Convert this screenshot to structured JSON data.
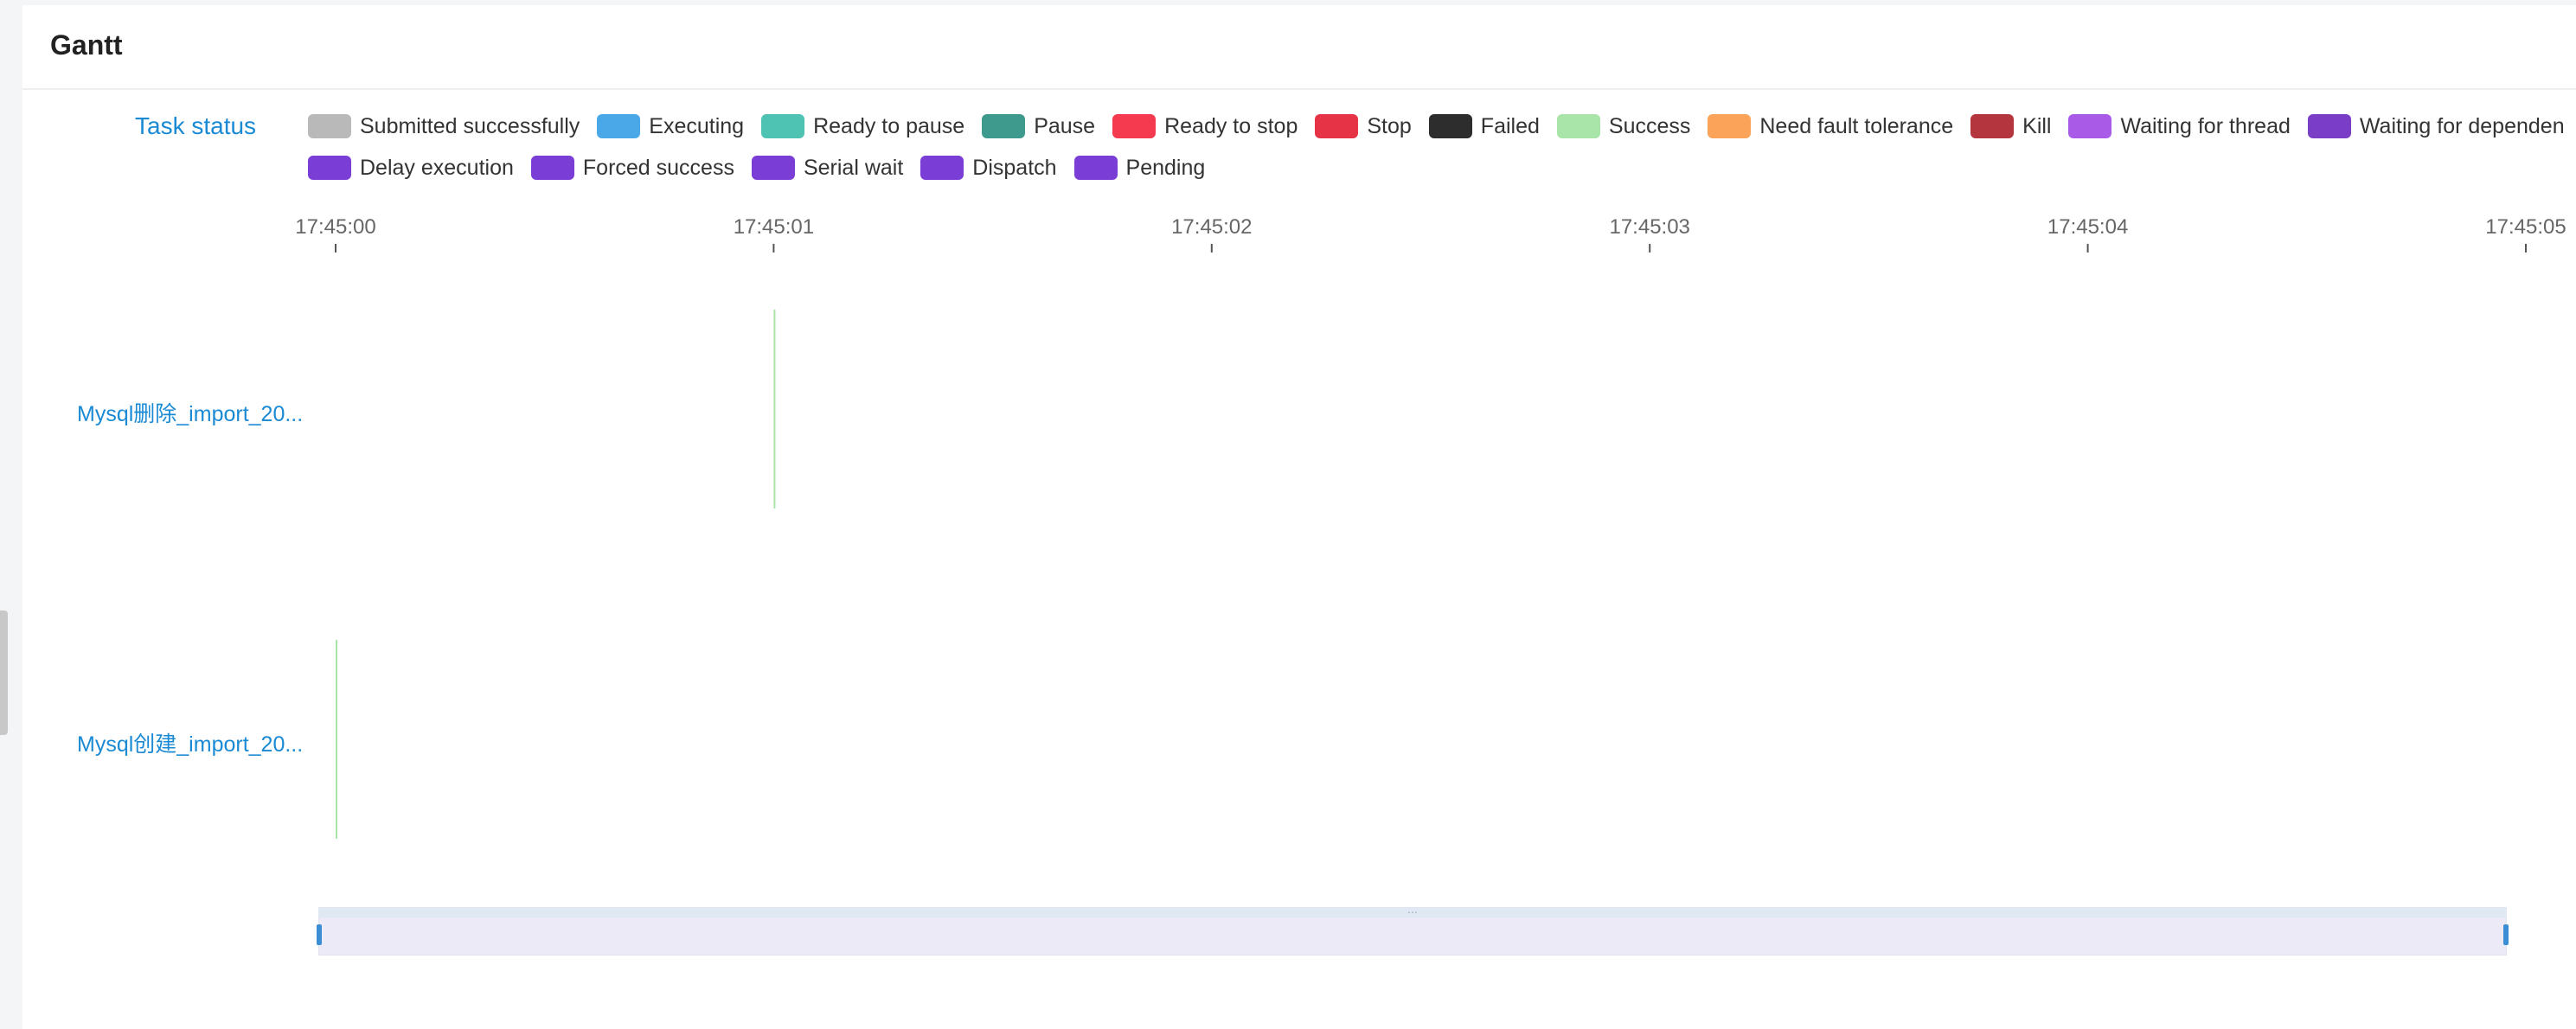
{
  "card": {
    "title": "Gantt"
  },
  "legend": {
    "title": "Task status",
    "rows": [
      [
        {
          "label": "Submitted successfully",
          "color": "#b9b9b9"
        },
        {
          "label": "Executing",
          "color": "#4aa8e8"
        },
        {
          "label": "Ready to pause",
          "color": "#4ec3b4"
        },
        {
          "label": "Pause",
          "color": "#3f9a8e"
        },
        {
          "label": "Ready to stop",
          "color": "#f5394e"
        },
        {
          "label": "Stop",
          "color": "#e73346"
        },
        {
          "label": "Failed",
          "color": "#2d2d2d"
        },
        {
          "label": "Success",
          "color": "#a9e4a8"
        },
        {
          "label": "Need fault tolerance",
          "color": "#fca35a"
        },
        {
          "label": "Kill",
          "color": "#b5353f"
        },
        {
          "label": "Waiting for thread",
          "color": "#a95ae6"
        },
        {
          "label": "Waiting for dependen",
          "color": "#7a3ec6"
        }
      ],
      [
        {
          "label": "Delay execution",
          "color": "#7a3ed6"
        },
        {
          "label": "Forced success",
          "color": "#7a3ed6"
        },
        {
          "label": "Serial wait",
          "color": "#7a3ed6"
        },
        {
          "label": "Dispatch",
          "color": "#7a3ed6"
        },
        {
          "label": "Pending",
          "color": "#7a3ed6"
        }
      ]
    ]
  },
  "chart_data": {
    "type": "gantt",
    "x_ticks": [
      "17:45:00",
      "17:45:01",
      "17:45:02",
      "17:45:03",
      "17:45:04",
      "17:45:05"
    ],
    "xlim": [
      "17:45:00",
      "17:45:05"
    ],
    "tasks": [
      {
        "label": "Mysql删除_import_20...",
        "start": "17:45:01",
        "end": "17:45:01",
        "status": "Success",
        "color": "#a9e4a8"
      },
      {
        "label": "Mysql创建_import_20...",
        "start": "17:45:00",
        "end": "17:45:00",
        "status": "Success",
        "color": "#a9e4a8"
      }
    ],
    "grid": false
  }
}
